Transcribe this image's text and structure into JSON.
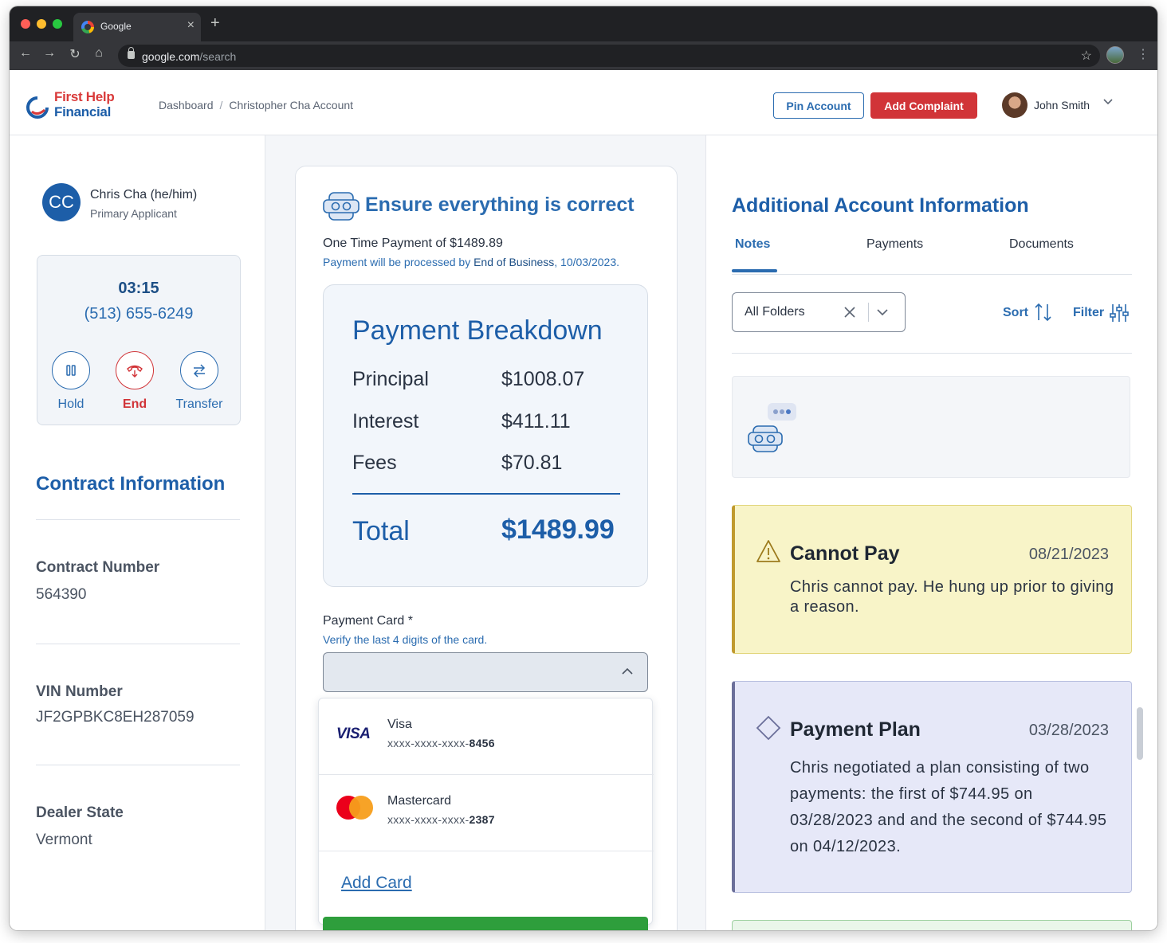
{
  "browser": {
    "tab_title": "Google",
    "url_host": "google.com",
    "url_path": "/search"
  },
  "header": {
    "logo_line1": "First Help",
    "logo_line2": "Financial",
    "breadcrumb": [
      "Dashboard",
      "Christopher Cha Account"
    ],
    "pin_label": "Pin Account",
    "complaint_label": "Add Complaint",
    "user_name": "John Smith"
  },
  "applicant": {
    "initials": "CC",
    "name": "Chris Cha (he/him)",
    "role": "Primary Applicant"
  },
  "call": {
    "timer": "03:15",
    "phone": "(513) 655-6249",
    "hold_label": "Hold",
    "end_label": "End",
    "transfer_label": "Transfer"
  },
  "contract": {
    "title": "Contract Information",
    "fields": [
      {
        "label": "Contract Number",
        "value": "564390"
      },
      {
        "label": "VIN Number",
        "value": "JF2GPBKC8EH287059"
      },
      {
        "label": "Dealer State",
        "value": "Vermont"
      }
    ]
  },
  "payment": {
    "title": "Ensure everything is correct",
    "otp_text": "One Time Payment of $1489.89",
    "otp_sub_prefix": "Payment will be processed by ",
    "otp_sub_bold": "End of Business",
    "otp_sub_suffix": ", 10/03/2023.",
    "breakdown": {
      "title": "Payment Breakdown",
      "rows": [
        {
          "label": "Principal",
          "value": "$1008.07"
        },
        {
          "label": "Interest",
          "value": "$411.11"
        },
        {
          "label": "Fees",
          "value": "$70.81"
        }
      ],
      "total_label": "Total",
      "total_value": "$1489.99"
    },
    "card_label": "Payment Card *",
    "card_hint": "Verify the last 4 digits of the card.",
    "cards": [
      {
        "brand": "Visa",
        "logo": "VISA",
        "mask": "xxxx-xxxx-xxxx-",
        "last4": "8456"
      },
      {
        "brand": "Mastercard",
        "mask": "xxxx-xxxx-xxxx-",
        "last4": "2387"
      }
    ],
    "add_card_label": "Add Card"
  },
  "account_info": {
    "title": "Additional Account Information",
    "tabs": [
      "Notes",
      "Payments",
      "Documents"
    ],
    "active_tab": "Notes",
    "folder_value": "All Folders",
    "sort_label": "Sort",
    "filter_label": "Filter",
    "notes": [
      {
        "title": "Cannot Pay",
        "date": "08/21/2023",
        "body": "Chris cannot pay. He hung up prior to giving a reason.",
        "icon": "warning-icon",
        "color": "#f8f4c8"
      },
      {
        "title": "Payment Plan",
        "date": "03/28/2023",
        "body": "Chris negotiated a plan consisting of two payments: the first of $744.95 on 03/28/2023 and and the second of $744.95 on 04/12/2023.",
        "icon": "diamond-icon",
        "color": "#e6e8f8"
      }
    ]
  },
  "colors": {
    "brand_blue": "#1d5ea8",
    "link_blue": "#2b6cb0",
    "danger_red": "#d13438",
    "success_green": "#2e9e3c"
  }
}
